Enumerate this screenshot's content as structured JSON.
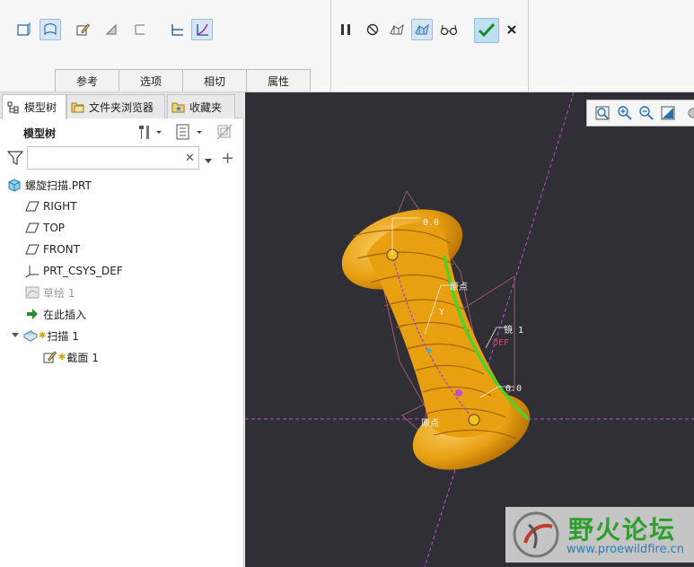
{
  "ribbon": {
    "tabs": [
      "参考",
      "选项",
      "相切",
      "属性"
    ],
    "tools": [
      "solid-sweep-icon",
      "surface-sweep-icon",
      "edit-section-icon",
      "remove-material-icon",
      "thicken-icon",
      "constant-section-icon",
      "variable-section-icon"
    ],
    "controls": [
      "pause-icon",
      "stop-icon",
      "preview-geometry-icon",
      "preview-feature-icon",
      "glasses-icon",
      "ok-icon",
      "cancel-icon"
    ]
  },
  "panel": {
    "tabs": [
      "模型树",
      "文件夹浏览器",
      "收藏夹"
    ],
    "header_title": "模型树",
    "search": {
      "value": "",
      "placeholder": ""
    }
  },
  "tree": [
    {
      "label": "螺旋扫描.PRT",
      "icon": "part-icon"
    },
    {
      "label": "RIGHT",
      "icon": "datum-plane-icon"
    },
    {
      "label": "TOP",
      "icon": "datum-plane-icon"
    },
    {
      "label": "FRONT",
      "icon": "datum-plane-icon"
    },
    {
      "label": "PRT_CSYS_DEF",
      "icon": "csys-icon"
    },
    {
      "label": "草绘 1",
      "icon": "sketch-icon",
      "dimmed": true
    },
    {
      "label": "在此插入",
      "icon": "insert-here-icon"
    },
    {
      "label": "扫描 1",
      "icon": "sweep-icon"
    },
    {
      "label": "截面 1",
      "icon": "section-icon"
    }
  ],
  "viewport": {
    "background": "#2f2f35",
    "solid_color": "#e8a011",
    "trajectory_color": "#4fd12a",
    "annotations": [
      "0.0",
      "原点",
      "Y",
      "镜 1",
      "DEF",
      "0.0",
      "原点"
    ]
  },
  "watermark": {
    "title": "野火论坛",
    "url": "www.proewildfire.cn"
  }
}
